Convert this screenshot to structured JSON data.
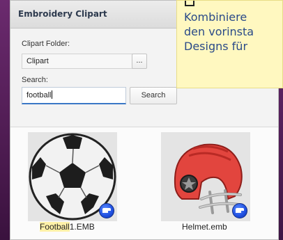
{
  "panel": {
    "title": "Embroidery Clipart",
    "clipart_folder": {
      "label": "Clipart Folder:",
      "value": "Clipart",
      "browse_label": "..."
    },
    "search": {
      "label": "Search:",
      "value": "football",
      "button_label": "Search"
    },
    "results": [
      {
        "caption_match": "Football",
        "caption_rest": "1.EMB",
        "icon": "soccer-ball-icon",
        "badge_icon": "sewing-machine-icon"
      },
      {
        "caption_match": "",
        "caption_rest": "Helmet.emb",
        "icon": "football-helmet-icon",
        "badge_icon": "sewing-machine-icon"
      }
    ]
  },
  "tooltip": {
    "icon": "square-icon",
    "text": "Kombiniere\nden vorinsta\nDesigns für"
  },
  "colors": {
    "highlight": "#fff1a8",
    "tooltip_bg": "#fff8c0",
    "tooltip_text": "#2a4a88",
    "helmet_red": "#e2453e",
    "badge_blue": "#1f4fe0"
  }
}
